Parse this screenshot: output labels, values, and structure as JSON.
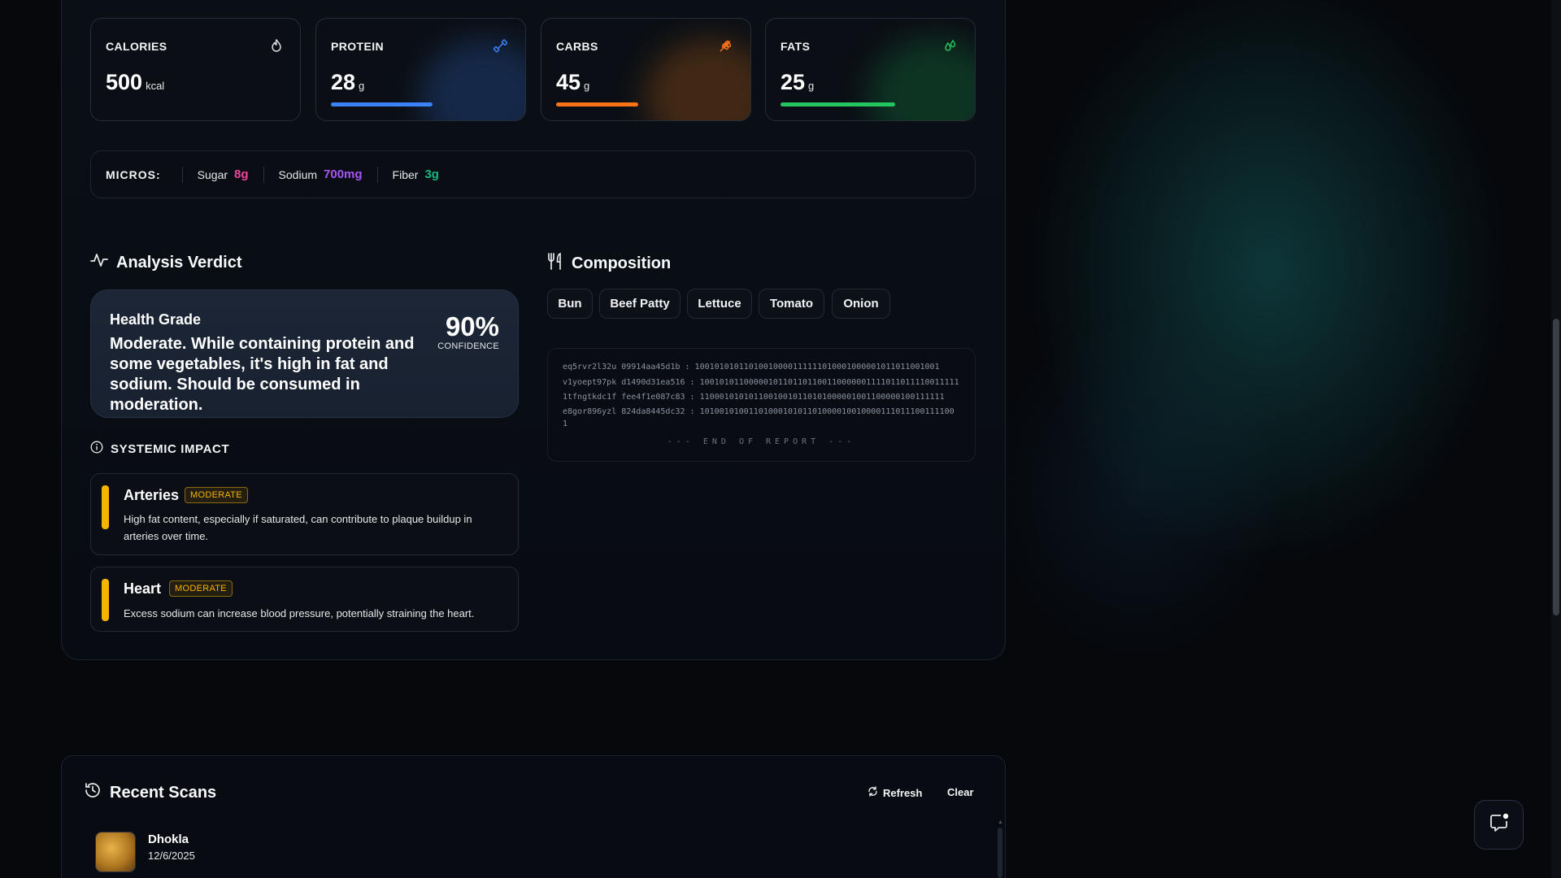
{
  "macros": [
    {
      "label": "CALORIES",
      "value": "500",
      "unit": "kcal",
      "icon": "flame-icon",
      "color": "#e5e7eb"
    },
    {
      "label": "PROTEIN",
      "value": "28",
      "unit": "g",
      "icon": "dumbbell-icon",
      "color": "#3b82f6",
      "fill": 0.57
    },
    {
      "label": "CARBS",
      "value": "45",
      "unit": "g",
      "icon": "wheat-icon",
      "color": "#f97316",
      "fill": 0.46
    },
    {
      "label": "FATS",
      "value": "25",
      "unit": "g",
      "icon": "droplet-icon",
      "color": "#22c55e",
      "fill": 0.64
    }
  ],
  "micros": {
    "title": "MICROS:",
    "items": [
      {
        "name": "Sugar",
        "value": "8g",
        "color": "#ec4899"
      },
      {
        "name": "Sodium",
        "value": "700mg",
        "color": "#a855f7"
      },
      {
        "name": "Fiber",
        "value": "3g",
        "color": "#10b981"
      }
    ]
  },
  "verdict": {
    "title": "Analysis Verdict",
    "grade_label": "Health Grade",
    "grade_text": "Moderate. While containing protein and some vegetables, it's high in fat and sodium. Should be consumed in moderation.",
    "confidence": "90%",
    "confidence_label": "CONFIDENCE"
  },
  "impact": {
    "title": "SYSTEMIC IMPACT",
    "items": [
      {
        "name": "Arteries",
        "level": "MODERATE",
        "description": "High fat content, especially if saturated, can contribute to plaque buildup in arteries over time."
      },
      {
        "name": "Heart",
        "level": "MODERATE",
        "description": "Excess sodium can increase blood pressure, potentially straining the heart."
      }
    ]
  },
  "composition": {
    "title": "Composition",
    "items": [
      "Bun",
      "Beef Patty",
      "Lettuce",
      "Tomato",
      "Onion"
    ]
  },
  "report": {
    "lines": [
      "eq5rvr2l32u 09914aa45d1b : 10010101011010010000111111010001000001011011001001",
      "v1yoept97pk d1490d31ea516 : 10010101100000101101101100110000001111011011110011111",
      "1tfngtkdc1f fee4f1e087c83 : 11000101010110010010110101000001001100000100111111",
      "e8gor896yzl 824da8445dc32 : 1010010100110100010101101000010010000111011100111100",
      "1"
    ],
    "end": "--- END OF REPORT ---"
  },
  "recent": {
    "title": "Recent Scans",
    "refresh_label": "Refresh",
    "clear_label": "Clear",
    "items": [
      {
        "name": "Dhokla",
        "date": "12/6/2025"
      }
    ]
  }
}
